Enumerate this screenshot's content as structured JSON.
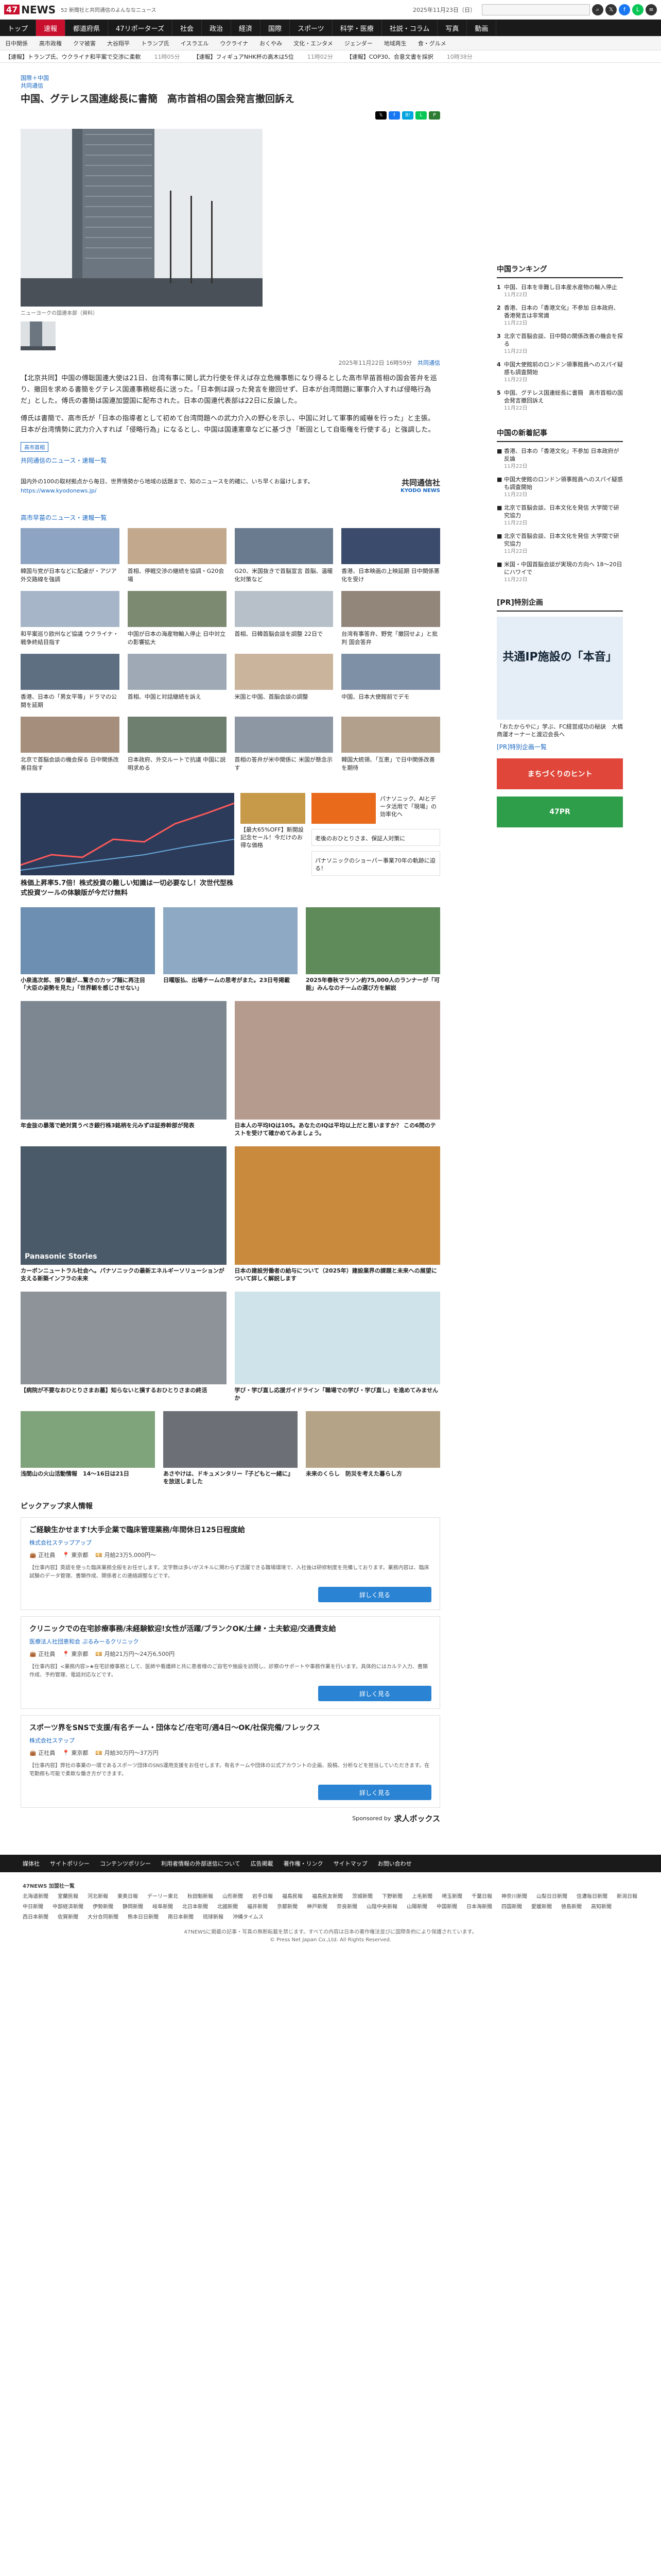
{
  "header": {
    "logo": "NEWS",
    "logo_mark": "47",
    "tagline": "52 新聞社と共同通信のよんななニュース",
    "date": "2025年11月23日（日）"
  },
  "main_nav": [
    "トップ",
    "速報",
    "都道府県",
    "47リポーターズ",
    "社会",
    "政治",
    "経済",
    "国際",
    "スポーツ",
    "科学・医療",
    "社説・コラム",
    "写真",
    "動画"
  ],
  "sub_nav": [
    "日中関係",
    "高市政権",
    "クマ被害",
    "大谷翔平",
    "トランプ氏",
    "イスラエル",
    "ウクライナ",
    "おくやみ",
    "文化・エンタメ",
    "ジェンダー",
    "地域再生",
    "食・グルメ"
  ],
  "ticker": [
    {
      "label": "【速報】トランプ氏、ウクライナ和平案で交渉に柔軟",
      "time": "11時05分"
    },
    {
      "label": "【速報】フィギュアNHK杯の高木は5位",
      "time": "11時02分"
    },
    {
      "label": "【速報】COP30、合意文書を採択",
      "time": "10時38分"
    }
  ],
  "article": {
    "crumbs": [
      "国際＋中国",
      "共同通信"
    ],
    "title": "中国、グテレス国連総長に書簡　高市首相の国会発言撤回訴え",
    "caption": "ニューヨークの国連本部（資料）",
    "byline": "2025年11月22日 16時59分",
    "byline_src": "共同通信",
    "paragraphs": [
      "【北京共同】中国の傅聡国連大使は21日、台湾有事に関し武力行使を伴えば存立危機事態になり得るとした高市早苗首相の国会答弁を巡り、撤回を求める書簡をグテレス国連事務総長に送った。「日本側は誤った発言を撤回せず、日本が台湾問題に軍事介入すれば侵略行為だ」とした。傅氏の書簡は国連加盟国に配布された。日本の国連代表部は22日に反論した。",
      "傅氏は書簡で、高市氏が「日本の指導者として初めて台湾問題への武力介入の野心を示し、中国に対して軍事的威嚇を行った」と主張。日本が台湾情勢に武力介入すれば「侵略行為」になるとし、中国は国連憲章などに基づき「断固として自衛権を行使する」と強調した。"
    ],
    "tag": "高市首相",
    "more_link": "共同通信のニュース・速報一覧",
    "promo_text": "国内外の100の取材拠点から毎日、世界情勢から地域の話題まで、知のニュースを的確に、いち早くお届けします。",
    "promo_link": "https://www.kyodonews.jp/",
    "promo_logo": "共同通信社",
    "promo_logo_en": "KYODO NEWS"
  },
  "related": {
    "title": "高市早苗のニュース・速報一覧",
    "items": [
      "韓国与党が日本などに配慮が・アジア外交路線を強調",
      "首相、停戦交渉の継続を協調・G20会場",
      "G20、米国抜きで首脳宣言 首脳、温暖化対策など",
      "香港、日本映画の上映延期 日中関係悪化を受け",
      "和平案巡り欧州など協議 ウクライナ・戦争終結目指す",
      "中国が日本の海産物輸入停止 日中対立の影響拡大",
      "首相、日韓首脳会談を調整 22日で",
      "台湾有事答弁、野党「撤回せよ」と批判 国会答弁",
      "香港、日本の「男女平等」ドラマの公開を延期",
      "首相、中国と対話継続を訴え",
      "米国と中国、首脳会談の調整",
      "中国、日本大使館前でデモ",
      "北京で首脳会談の機会探る 日中関係改善目指す",
      "日本政府、外交ルートで抗議 中国に説明求める",
      "首相の答弁が米中関係に 米国が懸念示す",
      "韓国大統領、「互恵」で日中関係改善を期待"
    ]
  },
  "ads": {
    "a1": "株価上昇率5.7倍！株式投資の難しい知識は一切必要なし！次世代型株式投資ツールの体験版が今だけ無料",
    "a2": "【最大65%OFF】新開設記念セール！今だけのお得な価格",
    "a3": "パナソニック、AIとデータ活用で「現場」の効率化へ",
    "a4": "老後のおひとりさま、保証人対策に",
    "a5": "パナソニックのショーパー事業70年の軌跡に迫る！",
    "b1": "小泉進次郎、揺り籠が…驚きのカップ麺に再注目「大臣の姿勢を見た」「世界観を感じさせない」",
    "b2": "日曜版払、出場チームの思考がまた。23日号掲載",
    "b3": "2025年春秋マラソン約75,000人のランナーが「可能」みんなのチームの選び方を解説",
    "c1": "年金抜の暴落で絶対買うべき銀行株3銘柄を元みずほ証券幹部が発表",
    "c2": "日本人の平均IQは105。あなたのIQは平均以上だと思いますか？ この6問のテストを受けて確かめてみましょう。",
    "d1": "カーボンニュートラル社会へ。パナソニックの最新エネルギーソリューションが支える新築インフラの未来",
    "d2": "日本の建設労働者の給与について（2025年）建設業界の課題と未来への展望について詳しく解説します",
    "e1": "【病院が不要なおひとりさまお墓】知らないと損するおひとりさまの終活",
    "e2": "学び・学び直し応援ガイドライン「職場での学び・学び直し」を進めてみませんか",
    "e3": "寒暖差対策に！冬の健康ガイド",
    "f1": "浅間山の火山活動情報　14〜16日は21日",
    "f2": "あさやけは、ドキュメンタリー『子どもと一緒に』を放送しました",
    "f3": "未来のくらし　防災を考えた暮らし方"
  },
  "jobs": {
    "title": "ピックアップ求人情報",
    "items": [
      {
        "title": "ご経験生かせます!大手企業で臨床管理業務/年間休日125日程度給",
        "company": "株式会社ステップアップ",
        "place": "正社員",
        "area": "東京都",
        "salary": "月給23万5,000円〜",
        "desc": "【仕事内容】英語を使った臨床業務全般をお任せします。文字数は多いがスキルに関わらず活躍できる職場環境で、入社後は研修制度を完備しております。業務内容は、臨床試験のデータ管理、書類作成、関係者との連絡調整などです。"
      },
      {
        "title": "クリニックでの在宅診療事務/未経験歓迎!女性が活躍/ブランクOK/土練・土夫歓迎/交通費支給",
        "company": "医療法人社団恵和会 ぷるみーるクリニック",
        "place": "正社員",
        "area": "東京都",
        "salary": "月給21万円〜24万6,500円",
        "desc": "【仕事内容】<業務内容>★在宅診療事務として、医師や看護師と共に患者様のご自宅や施設を訪問し、診察のサポートや事務作業を行います。具体的にはカルテ入力、書類作成、予約管理、電話対応などです。"
      },
      {
        "title": "スポーツ界をSNSで支援/有名チーム・団体など/在宅可/週4日〜OK/社保完備/フレックス",
        "company": "株式会社ステップ",
        "place": "正社員",
        "area": "東京都",
        "salary": "月給30万円〜37万円",
        "desc": "【仕事内容】弊社の事業の一環であるスポーツ団体のSNS運用支援をお任せします。有名チームや団体の公式アカウントの企画、投稿、分析などを担当していただきます。在宅勤務も可能で柔軟な働き方ができます。"
      }
    ],
    "button": "詳しく見る",
    "sponsored_by": "Sponsored by",
    "sponsor": "求人ボックス"
  },
  "sidebar": {
    "ranking_title": "中国ランキング",
    "ranking": [
      {
        "t": "中国、日本を非難し日本産水産物の輸入停止",
        "tm": "11月22日"
      },
      {
        "t": "香港、日本の「香港文化」不参加 日本政府、香港発言は非常識",
        "tm": "11月22日"
      },
      {
        "t": "北京で首脳会談、日中間の関係改善の機会を探る",
        "tm": "11月22日"
      },
      {
        "t": "中国大使館前のロンドン領事館員へのスパイ疑惑も調査開始",
        "tm": "11月22日"
      },
      {
        "t": "中国、グテレス国連総長に書簡　高市首相の国会発言撤回訴え",
        "tm": "11月22日"
      }
    ],
    "new_title": "中国の新着記事",
    "new": [
      {
        "t": "香港、日本の「香港文化」不参加 日本政府が反論",
        "tm": "11月22日"
      },
      {
        "t": "中国大使館のロンドン領事館員へのスパイ疑惑も調査開始",
        "tm": "11月22日"
      },
      {
        "t": "北京で首脳会談、日本文化を発信 大学間で研究協力",
        "tm": "11月22日"
      },
      {
        "t": "北京で首脳会談、日本文化を発信 大学間で研究協力",
        "tm": "11月22日"
      },
      {
        "t": "米国・中国首脳会談が実現の方向へ 18〜20日にハワイで",
        "tm": "11月22日"
      }
    ],
    "pr_title": "[PR]特別企画",
    "pr_box": "共通IP施設の「本音」",
    "pr_text": "「おたからやに」学ぶ、FC経営成功の秘訣　大橋商運オーナーと渡辺会長へ",
    "pr_link": "[PR]特別企画一覧",
    "banner1": "まちづくりのヒント",
    "banner2": "47PR"
  },
  "footer": {
    "nav": [
      "媒体社",
      "サイトポリシー",
      "コンテンツポリシー",
      "利用者情報の外部送信について",
      "広告掲載",
      "著作権・リンク",
      "サイトマップ",
      "お問い合わせ"
    ],
    "company": "47NEWS 加盟社一覧",
    "sites": [
      "北海道新聞",
      "室蘭民報",
      "河北新報",
      "東奥日報",
      "デーリー東北",
      "秋田魁新報",
      "山形新聞",
      "岩手日報",
      "福島民報",
      "福島民友新聞",
      "茨城新聞",
      "下野新聞",
      "上毛新聞",
      "埼玉新聞",
      "千葉日報",
      "神奈川新聞",
      "山梨日日新聞",
      "信濃毎日新聞",
      "新潟日報",
      "中日新聞",
      "中部経済新聞",
      "伊勢新聞",
      "静岡新聞",
      "岐阜新聞",
      "北日本新聞",
      "北國新聞",
      "福井新聞",
      "京都新聞",
      "神戸新聞",
      "奈良新聞",
      "山陰中央新報",
      "山陽新聞",
      "中国新聞",
      "日本海新聞",
      "四国新聞",
      "愛媛新聞",
      "徳島新聞",
      "高知新聞",
      "西日本新聞",
      "佐賀新聞",
      "大分合同新聞",
      "熊本日日新聞",
      "南日本新聞",
      "琉球新報",
      "沖縄タイムス"
    ],
    "copyright1": "47NEWSに掲載の記事・写真の無断転載を禁じます。すべての内容は日本の著作権法並びに国際条約により保護されています。",
    "copyright2": "© Press Net Japan Co.,Ltd. All Rights Reserved."
  }
}
